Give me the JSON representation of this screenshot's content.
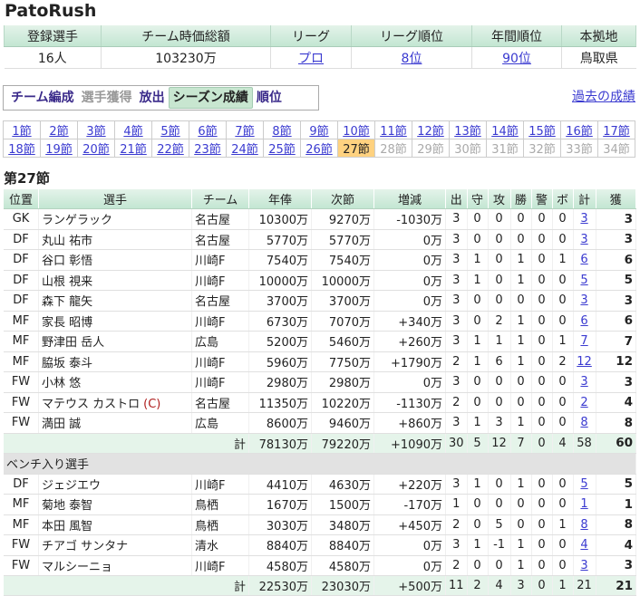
{
  "site_title": "PatoRush",
  "summary": {
    "headers": [
      "登録選手",
      "チーム時価総額",
      "リーグ",
      "リーグ順位",
      "年間順位",
      "本拠地"
    ],
    "players": "16人",
    "team_value": "103230万",
    "league": "プロ",
    "league_rank": "8位",
    "year_rank": "90位",
    "home": "鳥取県"
  },
  "nav": {
    "items": [
      "チーム編成",
      "選手獲得",
      "放出",
      "シーズン成績",
      "順位"
    ],
    "past_link": "過去の成績"
  },
  "rounds": [
    [
      "1節",
      "2節",
      "3節",
      "4節",
      "5節",
      "6節",
      "7節",
      "8節",
      "9節",
      "10節",
      "11節",
      "12節",
      "13節",
      "14節",
      "15節",
      "16節",
      "17節"
    ],
    [
      "18節",
      "19節",
      "20節",
      "21節",
      "22節",
      "23節",
      "24節",
      "25節",
      "26節",
      "27節",
      "28節",
      "29節",
      "30節",
      "31節",
      "32節",
      "33節",
      "34節"
    ]
  ],
  "section_title": "第27節",
  "table": {
    "headers": [
      "位置",
      "選手",
      "チーム",
      "年俸",
      "次節",
      "増減",
      "出",
      "守",
      "攻",
      "勝",
      "警",
      "ボ",
      "計",
      "獲"
    ],
    "starters": [
      {
        "pos": "GK",
        "name": "ランゲラック",
        "team": "名古屋",
        "salary": "10300万",
        "next": "9270万",
        "diff": "-1030万",
        "a": "3",
        "b": "0",
        "c": "0",
        "d": "0",
        "e": "0",
        "f": "0",
        "sum": "3",
        "get": "3"
      },
      {
        "pos": "DF",
        "name": "丸山 祐市",
        "team": "名古屋",
        "salary": "5770万",
        "next": "5770万",
        "diff": "0万",
        "a": "3",
        "b": "0",
        "c": "0",
        "d": "0",
        "e": "0",
        "f": "0",
        "sum": "3",
        "get": "3"
      },
      {
        "pos": "DF",
        "name": "谷口 彰悟",
        "team": "川崎F",
        "salary": "7540万",
        "next": "7540万",
        "diff": "0万",
        "a": "3",
        "b": "1",
        "c": "0",
        "d": "1",
        "e": "0",
        "f": "1",
        "sum": "6",
        "get": "6"
      },
      {
        "pos": "DF",
        "name": "山根 視来",
        "team": "川崎F",
        "salary": "10000万",
        "next": "10000万",
        "diff": "0万",
        "a": "3",
        "b": "1",
        "c": "0",
        "d": "1",
        "e": "0",
        "f": "0",
        "sum": "5",
        "get": "5"
      },
      {
        "pos": "DF",
        "name": "森下 龍矢",
        "team": "名古屋",
        "salary": "3700万",
        "next": "3700万",
        "diff": "0万",
        "a": "3",
        "b": "0",
        "c": "0",
        "d": "0",
        "e": "0",
        "f": "0",
        "sum": "3",
        "get": "3"
      },
      {
        "pos": "MF",
        "name": "家長 昭博",
        "team": "川崎F",
        "salary": "6730万",
        "next": "7070万",
        "diff": "+340万",
        "a": "3",
        "b": "0",
        "c": "2",
        "d": "1",
        "e": "0",
        "f": "0",
        "sum": "6",
        "get": "6"
      },
      {
        "pos": "MF",
        "name": "野津田 岳人",
        "team": "広島",
        "salary": "5200万",
        "next": "5460万",
        "diff": "+260万",
        "a": "3",
        "b": "1",
        "c": "1",
        "d": "1",
        "e": "0",
        "f": "1",
        "sum": "7",
        "get": "7"
      },
      {
        "pos": "MF",
        "name": "脇坂 泰斗",
        "team": "川崎F",
        "salary": "5960万",
        "next": "7750万",
        "diff": "+1790万",
        "a": "2",
        "b": "1",
        "c": "6",
        "d": "1",
        "e": "0",
        "f": "2",
        "sum": "12",
        "get": "12"
      },
      {
        "pos": "FW",
        "name": "小林 悠",
        "team": "川崎F",
        "salary": "2980万",
        "next": "2980万",
        "diff": "0万",
        "a": "3",
        "b": "0",
        "c": "0",
        "d": "0",
        "e": "0",
        "f": "0",
        "sum": "3",
        "get": "3"
      },
      {
        "pos": "FW",
        "name": "マテウス カストロ",
        "captain": "(C)",
        "team": "名古屋",
        "salary": "11350万",
        "next": "10220万",
        "diff": "-1130万",
        "a": "2",
        "b": "0",
        "c": "0",
        "d": "0",
        "e": "0",
        "f": "0",
        "sum": "2",
        "get": "4"
      },
      {
        "pos": "FW",
        "name": "満田 誠",
        "team": "広島",
        "salary": "8600万",
        "next": "9460万",
        "diff": "+860万",
        "a": "3",
        "b": "1",
        "c": "3",
        "d": "1",
        "e": "0",
        "f": "0",
        "sum": "8",
        "get": "8"
      }
    ],
    "starters_total": {
      "label": "計",
      "salary": "78130万",
      "next": "79220万",
      "diff": "+1090万",
      "a": "30",
      "b": "5",
      "c": "12",
      "d": "7",
      "e": "0",
      "f": "4",
      "sum": "58",
      "get": "60"
    },
    "bench_title": "ベンチ入り選手",
    "bench": [
      {
        "pos": "DF",
        "name": "ジェジエウ",
        "team": "川崎F",
        "salary": "4410万",
        "next": "4630万",
        "diff": "+220万",
        "a": "3",
        "b": "1",
        "c": "0",
        "d": "1",
        "e": "0",
        "f": "0",
        "sum": "5",
        "get": "5"
      },
      {
        "pos": "MF",
        "name": "菊地 泰智",
        "team": "鳥栖",
        "salary": "1670万",
        "next": "1500万",
        "diff": "-170万",
        "a": "1",
        "b": "0",
        "c": "0",
        "d": "0",
        "e": "0",
        "f": "0",
        "sum": "1",
        "get": "1"
      },
      {
        "pos": "MF",
        "name": "本田 風智",
        "team": "鳥栖",
        "salary": "3030万",
        "next": "3480万",
        "diff": "+450万",
        "a": "2",
        "b": "0",
        "c": "5",
        "d": "0",
        "e": "0",
        "f": "1",
        "sum": "8",
        "get": "8"
      },
      {
        "pos": "FW",
        "name": "チアゴ サンタナ",
        "team": "清水",
        "salary": "8840万",
        "next": "8840万",
        "diff": "0万",
        "a": "3",
        "b": "1",
        "c": "-1",
        "d": "1",
        "e": "0",
        "f": "0",
        "sum": "4",
        "get": "4"
      },
      {
        "pos": "FW",
        "name": "マルシーニョ",
        "team": "川崎F",
        "salary": "4580万",
        "next": "4580万",
        "diff": "0万",
        "a": "2",
        "b": "0",
        "c": "0",
        "d": "1",
        "e": "0",
        "f": "0",
        "sum": "3",
        "get": "3"
      }
    ],
    "bench_total": {
      "label": "計",
      "salary": "22530万",
      "next": "23030万",
      "diff": "+500万",
      "a": "11",
      "b": "2",
      "c": "4",
      "d": "3",
      "e": "0",
      "f": "1",
      "sum": "21",
      "get": "21"
    }
  }
}
